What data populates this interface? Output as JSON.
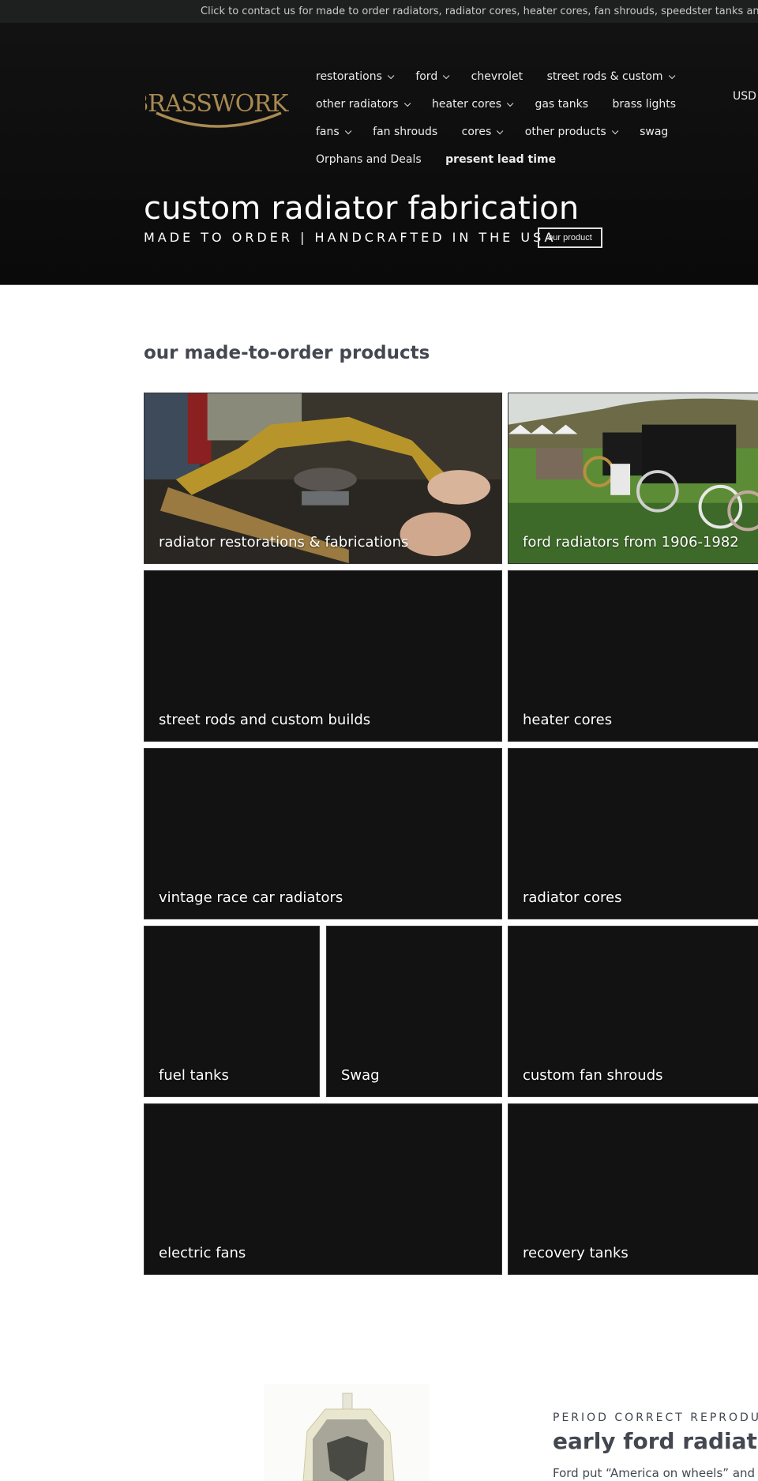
{
  "announcement": {
    "text": "Click to contact us for made to order radiators, radiator cores, heater cores, fan shrouds, speedster tanks and much m"
  },
  "brand": {
    "logo_text": "BRASSWORKS",
    "logo_color": "#a88a52"
  },
  "nav": {
    "rows": [
      [
        {
          "label": "restorations",
          "dropdown": true
        },
        {
          "label": "ford",
          "dropdown": true
        },
        {
          "label": "chevrolet",
          "dropdown": false
        },
        {
          "label": "street rods & custom",
          "dropdown": true
        }
      ],
      [
        {
          "label": "other radiators",
          "dropdown": true
        },
        {
          "label": "heater cores",
          "dropdown": true
        },
        {
          "label": "gas tanks",
          "dropdown": false
        },
        {
          "label": "brass lights",
          "dropdown": false
        }
      ],
      [
        {
          "label": "fans",
          "dropdown": true
        },
        {
          "label": "fan shrouds",
          "dropdown": false
        },
        {
          "label": "cores",
          "dropdown": true
        },
        {
          "label": "other products",
          "dropdown": true
        },
        {
          "label": "swag",
          "dropdown": false
        }
      ],
      [
        {
          "label": "Orphans and Deals",
          "dropdown": false
        },
        {
          "label": "present lead time",
          "dropdown": false,
          "bold": true
        }
      ]
    ],
    "currency": "USD"
  },
  "hero": {
    "title": "custom radiator fabrication",
    "subtitle": "MADE TO ORDER | HANDCRAFTED IN THE USA",
    "button_label": "our product"
  },
  "products": {
    "section_title": "our made-to-order products",
    "tiles": [
      {
        "label": "radiator restorations & fabrications",
        "image": "workshop-photo"
      },
      {
        "label": "ford radiators from 1906-1982",
        "image": "car-show-photo"
      },
      {
        "label": "street rods and custom builds"
      },
      {
        "label": "heater cores"
      },
      {
        "label": "vintage race car radiators"
      },
      {
        "label": "radiator cores"
      },
      {
        "label": "fuel tanks"
      },
      {
        "label": "Swag"
      },
      {
        "label": "custom fan shrouds"
      },
      {
        "label": "electric fans"
      },
      {
        "label": "recovery tanks"
      }
    ]
  },
  "feature": {
    "eyebrow": "PERIOD CORRECT REPRODUCT",
    "title": "early ford radiators",
    "text": "Ford put “America on wheels” and"
  }
}
